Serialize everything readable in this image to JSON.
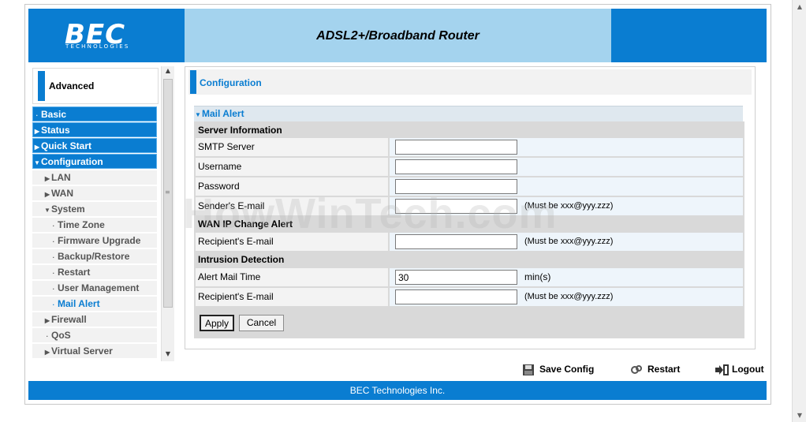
{
  "header": {
    "logo": "BEC",
    "logo_sub": "TECHNOLOGIES",
    "title": "ADSL2+/Broadband Router"
  },
  "sidebar": {
    "mode": "Advanced",
    "items": [
      {
        "label": "Basic",
        "level": "top",
        "marker": "dot"
      },
      {
        "label": "Status",
        "level": "top",
        "marker": "arrow-right"
      },
      {
        "label": "Quick Start",
        "level": "top",
        "marker": "arrow-right"
      },
      {
        "label": "Configuration",
        "level": "top",
        "marker": "arrow-down"
      },
      {
        "label": "LAN",
        "level": "sub",
        "marker": "arrow-right"
      },
      {
        "label": "WAN",
        "level": "sub",
        "marker": "arrow-right"
      },
      {
        "label": "System",
        "level": "sub",
        "marker": "arrow-down"
      },
      {
        "label": "Time Zone",
        "level": "subsub",
        "marker": "dot"
      },
      {
        "label": "Firmware Upgrade",
        "level": "subsub",
        "marker": "dot"
      },
      {
        "label": "Backup/Restore",
        "level": "subsub",
        "marker": "dot"
      },
      {
        "label": "Restart",
        "level": "subsub",
        "marker": "dot"
      },
      {
        "label": "User Management",
        "level": "subsub",
        "marker": "dot"
      },
      {
        "label": "Mail Alert",
        "level": "subsub",
        "marker": "dot",
        "active": true
      },
      {
        "label": "Firewall",
        "level": "sub",
        "marker": "arrow-right"
      },
      {
        "label": "QoS",
        "level": "sub",
        "marker": "dot"
      },
      {
        "label": "Virtual Server",
        "level": "sub",
        "marker": "arrow-right"
      }
    ]
  },
  "content": {
    "section_title": "Configuration",
    "panel_title": "Mail Alert",
    "server_info": {
      "heading": "Server Information",
      "smtp_label": "SMTP Server",
      "smtp_value": "",
      "username_label": "Username",
      "username_value": "",
      "password_label": "Password",
      "password_value": "",
      "sender_label": "Sender's E-mail",
      "sender_value": "",
      "sender_hint": "(Must be xxx@yyy.zzz)"
    },
    "wan_alert": {
      "heading": "WAN IP Change Alert",
      "recipient_label": "Recipient's E-mail",
      "recipient_value": "",
      "recipient_hint": "(Must be xxx@yyy.zzz)"
    },
    "intrusion": {
      "heading": "Intrusion Detection",
      "alert_time_label": "Alert Mail Time",
      "alert_time_value": "30",
      "alert_time_unit": "min(s)",
      "recipient_label": "Recipient's E-mail",
      "recipient_value": "",
      "recipient_hint": "(Must be xxx@yyy.zzz)"
    },
    "apply_label": "Apply",
    "cancel_label": "Cancel"
  },
  "actions": {
    "save_config": "Save Config",
    "restart": "Restart",
    "logout": "Logout"
  },
  "footer": {
    "text": "BEC Technologies Inc."
  },
  "watermark": "HowWinTech.com",
  "colors": {
    "accent": "#0a7dd1",
    "header_light": "#a4d3ee",
    "value_cell": "#eef5fb"
  }
}
